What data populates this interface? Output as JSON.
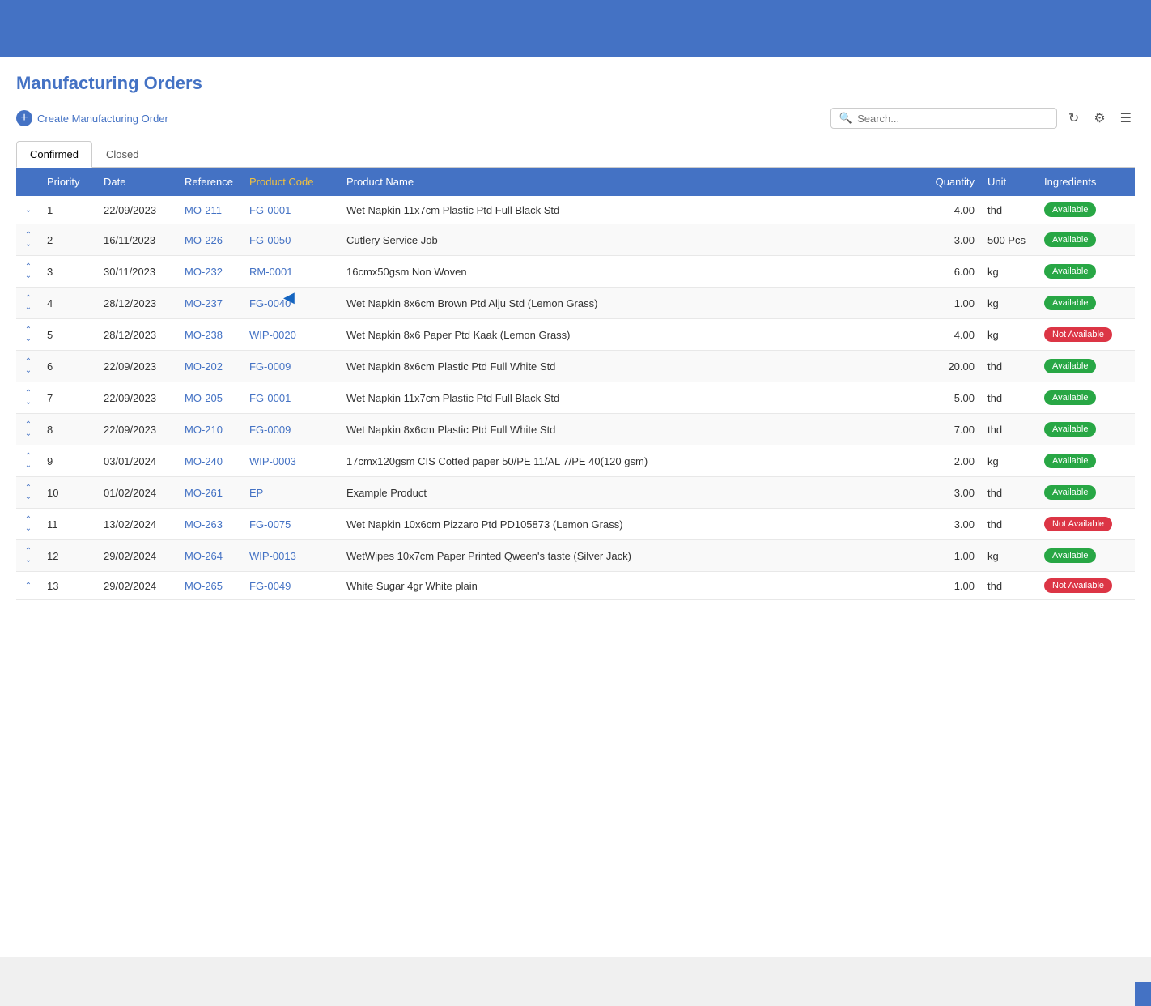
{
  "header": {
    "title": "Manufacturing Orders"
  },
  "toolbar": {
    "create_label": "Create Manufacturing Order",
    "search_placeholder": "Search..."
  },
  "tabs": [
    {
      "label": "Confirmed",
      "active": true
    },
    {
      "label": "Closed",
      "active": false
    }
  ],
  "table": {
    "columns": [
      "",
      "Priority",
      "Date",
      "Reference",
      "Product Code",
      "Product Name",
      "Quantity",
      "Unit",
      "Ingredients"
    ],
    "rows": [
      {
        "id": 1,
        "priority": "1",
        "date": "22/09/2023",
        "reference": "MO-211",
        "product_code": "FG-0001",
        "product_name": "Wet Napkin 11x7cm Plastic Ptd Full Black Std",
        "quantity": "4.00",
        "unit": "thd",
        "ingredients": "Available",
        "sort": "down"
      },
      {
        "id": 2,
        "priority": "2",
        "date": "16/11/2023",
        "reference": "MO-226",
        "product_code": "FG-0050",
        "product_name": "Cutlery Service Job",
        "quantity": "3.00",
        "unit": "500 Pcs",
        "ingredients": "Available",
        "sort": "both"
      },
      {
        "id": 3,
        "priority": "3",
        "date": "30/11/2023",
        "reference": "MO-232",
        "product_code": "RM-0001",
        "product_name": "16cmx50gsm Non Woven",
        "quantity": "6.00",
        "unit": "kg",
        "ingredients": "Available",
        "sort": "both"
      },
      {
        "id": 4,
        "priority": "4",
        "date": "28/12/2023",
        "reference": "MO-237",
        "product_code": "FG-0040",
        "product_name": "Wet Napkin 8x6cm Brown Ptd Alju Std (Lemon Grass)",
        "quantity": "1.00",
        "unit": "kg",
        "ingredients": "Available",
        "sort": "both",
        "cursor": true
      },
      {
        "id": 5,
        "priority": "5",
        "date": "28/12/2023",
        "reference": "MO-238",
        "product_code": "WIP-0020",
        "product_name": "Wet Napkin 8x6 Paper Ptd Kaak (Lemon Grass)",
        "quantity": "4.00",
        "unit": "kg",
        "ingredients": "Not Available",
        "sort": "both"
      },
      {
        "id": 6,
        "priority": "6",
        "date": "22/09/2023",
        "reference": "MO-202",
        "product_code": "FG-0009",
        "product_name": "Wet Napkin 8x6cm Plastic Ptd Full White Std",
        "quantity": "20.00",
        "unit": "thd",
        "ingredients": "Available",
        "sort": "both"
      },
      {
        "id": 7,
        "priority": "7",
        "date": "22/09/2023",
        "reference": "MO-205",
        "product_code": "FG-0001",
        "product_name": "Wet Napkin 11x7cm Plastic Ptd Full Black Std",
        "quantity": "5.00",
        "unit": "thd",
        "ingredients": "Available",
        "sort": "both"
      },
      {
        "id": 8,
        "priority": "8",
        "date": "22/09/2023",
        "reference": "MO-210",
        "product_code": "FG-0009",
        "product_name": "Wet Napkin 8x6cm Plastic Ptd Full White Std",
        "quantity": "7.00",
        "unit": "thd",
        "ingredients": "Available",
        "sort": "both"
      },
      {
        "id": 9,
        "priority": "9",
        "date": "03/01/2024",
        "reference": "MO-240",
        "product_code": "WIP-0003",
        "product_name": "17cmx120gsm CIS Cotted paper 50/PE 11/AL 7/PE 40(120 gsm)",
        "quantity": "2.00",
        "unit": "kg",
        "ingredients": "Available",
        "sort": "both"
      },
      {
        "id": 10,
        "priority": "10",
        "date": "01/02/2024",
        "reference": "MO-261",
        "product_code": "EP",
        "product_name": "Example Product",
        "quantity": "3.00",
        "unit": "thd",
        "ingredients": "Available",
        "sort": "both"
      },
      {
        "id": 11,
        "priority": "11",
        "date": "13/02/2024",
        "reference": "MO-263",
        "product_code": "FG-0075",
        "product_name": "Wet Napkin 10x6cm Pizzaro Ptd PD105873 (Lemon Grass)",
        "quantity": "3.00",
        "unit": "thd",
        "ingredients": "Not Available",
        "sort": "both"
      },
      {
        "id": 12,
        "priority": "12",
        "date": "29/02/2024",
        "reference": "MO-264",
        "product_code": "WIP-0013",
        "product_name": "WetWipes 10x7cm Paper Printed Qween's taste (Silver Jack)",
        "quantity": "1.00",
        "unit": "kg",
        "ingredients": "Available",
        "sort": "both"
      },
      {
        "id": 13,
        "priority": "13",
        "date": "29/02/2024",
        "reference": "MO-265",
        "product_code": "FG-0049",
        "product_name": "White Sugar 4gr White plain",
        "quantity": "1.00",
        "unit": "thd",
        "ingredients": "Not Available",
        "sort": "up"
      }
    ]
  },
  "colors": {
    "accent": "#4472c4",
    "available": "#28a745",
    "not_available": "#dc3545"
  }
}
